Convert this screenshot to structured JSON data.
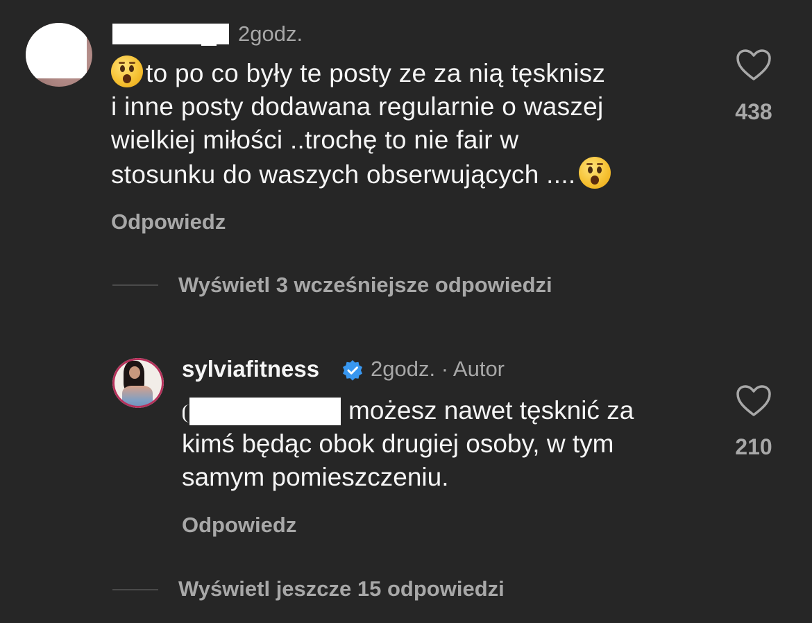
{
  "comment": {
    "time": "2godz.",
    "text_lines": [
      "to po co były te posty ze za nią tęsknisz",
      "i inne posty dodawana regularnie o waszej",
      "wielkiej miłości ..trochę to nie fair w",
      "stosunku do waszych obserwujących ...."
    ],
    "reply_label": "Odpowiedz",
    "like_count": "438"
  },
  "view_previous_replies": "Wyświetl 3 wcześniejsze odpowiedzi",
  "reply": {
    "username": "sylviafitness",
    "time_meta": "2godz. · Autor",
    "text_lines": [
      "możesz nawet tęsknić za",
      "kimś będąc obok drugiej osoby, w tym",
      "samym pomieszczeniu."
    ],
    "reply_label": "Odpowiedz",
    "like_count": "210"
  },
  "view_more_replies": "Wyświetl jeszcze 15 odpowiedzi",
  "colors": {
    "background": "#262626",
    "primary_text": "#f5f5f5",
    "secondary_text": "#a8a8a8",
    "verified_blue": "#3897f0"
  },
  "icons": [
    "heart-outline-icon",
    "verified-badge-icon",
    "astonished-face-emoji"
  ]
}
